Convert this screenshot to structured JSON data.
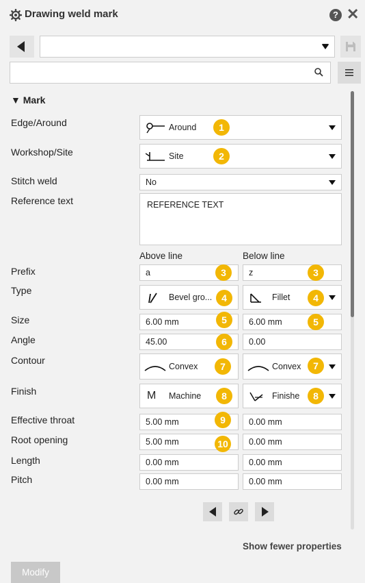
{
  "header": {
    "title": "Drawing weld mark",
    "help_icon": "help-icon",
    "close_icon": "close-icon",
    "help_glyph": "?",
    "close_glyph": "✕"
  },
  "toolbar": {
    "preset_value": "",
    "search_value": ""
  },
  "section": {
    "title": "▼ Mark"
  },
  "labels": {
    "edge_around": "Edge/Around",
    "workshop_site": "Workshop/Site",
    "stitch_weld": "Stitch weld",
    "reference_text": "Reference text",
    "prefix": "Prefix",
    "type": "Type",
    "size": "Size",
    "angle": "Angle",
    "contour": "Contour",
    "finish": "Finish",
    "effective_throat": "Effective throat",
    "root_opening": "Root opening",
    "length": "Length",
    "pitch": "Pitch"
  },
  "values": {
    "edge_around": "Around",
    "workshop_site": "Site",
    "stitch_weld": "No",
    "reference_text": "REFERENCE TEXT"
  },
  "columns": {
    "above": "Above line",
    "below": "Below line"
  },
  "above": {
    "prefix": "a",
    "type": "Bevel gro...",
    "size": "6.00 mm",
    "angle": "45.00",
    "contour": "Convex",
    "finish": "Machine",
    "effective_throat": "5.00 mm",
    "root_opening": "5.00 mm",
    "length": "0.00 mm",
    "pitch": "0.00 mm"
  },
  "below": {
    "prefix": "z",
    "type": "Fillet",
    "size": "6.00 mm",
    "angle": "0.00",
    "contour": "Convex",
    "finish": "Finishe",
    "effective_throat": "0.00 mm",
    "root_opening": "0.00 mm",
    "length": "0.00 mm",
    "pitch": "0.00 mm"
  },
  "type_glyphs": {
    "finish_above": "M"
  },
  "badges": {
    "edge_around": "1",
    "workshop_site": "2",
    "prefix_above": "3",
    "prefix_below": "3",
    "type_above": "4",
    "type_below": "4",
    "size_above": "5",
    "size_below": "5",
    "angle_above": "6",
    "contour_above": "7",
    "contour_below": "7",
    "finish_above": "8",
    "finish_below": "8",
    "effective_throat_above": "9",
    "root_opening_above": "10"
  },
  "footer": {
    "show_fewer": "Show fewer properties",
    "modify": "Modify"
  },
  "colors": {
    "badge": "#f2b705",
    "panel": "#f2f2f2"
  }
}
